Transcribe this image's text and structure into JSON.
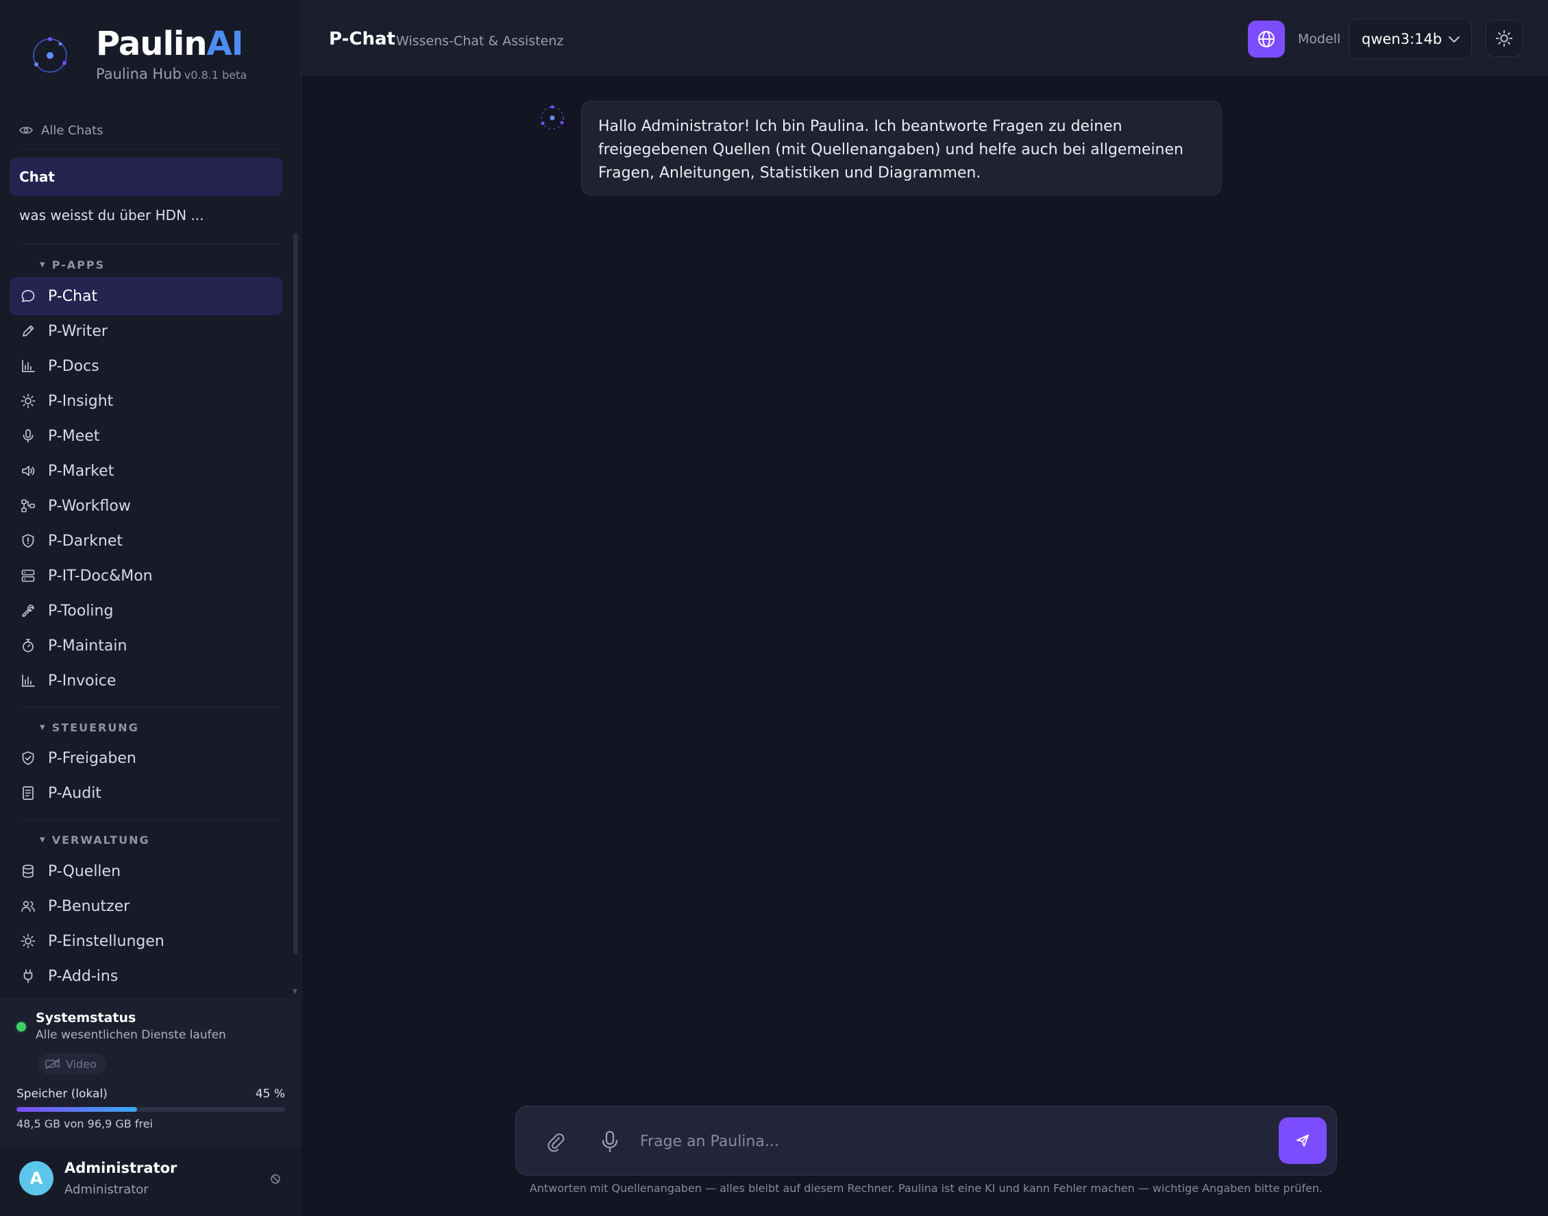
{
  "brand": {
    "name_prefix": "Paulin",
    "name_suffix": "AI",
    "subtitle": "Paulina Hub",
    "version": "v0.8.1 beta"
  },
  "sidebar": {
    "all_chats_label": "Alle Chats",
    "chats": [
      {
        "label": "Chat",
        "active": true
      },
      {
        "label": "was weisst du über HDN ...",
        "active": false
      }
    ],
    "sections": [
      {
        "title": "P-APPS",
        "items": [
          {
            "label": "P-Chat",
            "icon": "chat-bubble-icon",
            "active": true
          },
          {
            "label": "P-Writer",
            "icon": "pencil-icon"
          },
          {
            "label": "P-Docs",
            "icon": "bar-chart-icon"
          },
          {
            "label": "P-Insight",
            "icon": "sun-icon"
          },
          {
            "label": "P-Meet",
            "icon": "microphone-icon"
          },
          {
            "label": "P-Market",
            "icon": "megaphone-icon"
          },
          {
            "label": "P-Workflow",
            "icon": "workflow-icon"
          },
          {
            "label": "P-Darknet",
            "icon": "shield-alert-icon"
          },
          {
            "label": "P-IT-Doc&Mon",
            "icon": "server-icon"
          },
          {
            "label": "P-Tooling",
            "icon": "wrench-icon"
          },
          {
            "label": "P-Maintain",
            "icon": "stopwatch-icon"
          },
          {
            "label": "P-Invoice",
            "icon": "bar-chart-icon"
          }
        ]
      },
      {
        "title": "STEUERUNG",
        "items": [
          {
            "label": "P-Freigaben",
            "icon": "shield-check-icon"
          },
          {
            "label": "P-Audit",
            "icon": "document-icon"
          }
        ]
      },
      {
        "title": "VERWALTUNG",
        "items": [
          {
            "label": "P-Quellen",
            "icon": "database-icon"
          },
          {
            "label": "P-Benutzer",
            "icon": "users-icon"
          },
          {
            "label": "P-Einstellungen",
            "icon": "sun-icon"
          },
          {
            "label": "P-Add-ins",
            "icon": "plug-icon"
          }
        ]
      }
    ]
  },
  "status": {
    "title": "Systemstatus",
    "subtitle": "Alle wesentlichen Dienste laufen",
    "video_chip": "Video",
    "status_color": "#3ecf6a"
  },
  "storage": {
    "label": "Speicher (lokal)",
    "percent_text": "45 %",
    "percent": 45,
    "free_text": "48,5 GB von 96,9 GB frei"
  },
  "user": {
    "initial": "A",
    "name": "Administrator",
    "role": "Administrator"
  },
  "topbar": {
    "title": "P-Chat",
    "subtitle": "Wissens-Chat & Assistenz",
    "model_label": "Modell",
    "model_value": "qwen3:14b"
  },
  "chat": {
    "messages": [
      {
        "role": "assistant",
        "text": "Hallo Administrator! Ich bin Paulina. Ich beantworte Fragen zu deinen freigegebenen Quellen (mit Quellenangaben) und helfe auch bei allgemeinen Fragen, Anleitungen, Statistiken und Diagrammen."
      }
    ]
  },
  "composer": {
    "placeholder": "Frage an Paulina...",
    "disclaimer": "Antworten mit Quellenangaben — alles bleibt auf diesem Rechner. Paulina ist eine KI und kann Fehler machen — wichtige Angaben bitte prüfen."
  },
  "colors": {
    "accent": "#7c4dff",
    "brand_blue": "#4f8df5",
    "active_bg": "#262351",
    "background": "#131522"
  }
}
